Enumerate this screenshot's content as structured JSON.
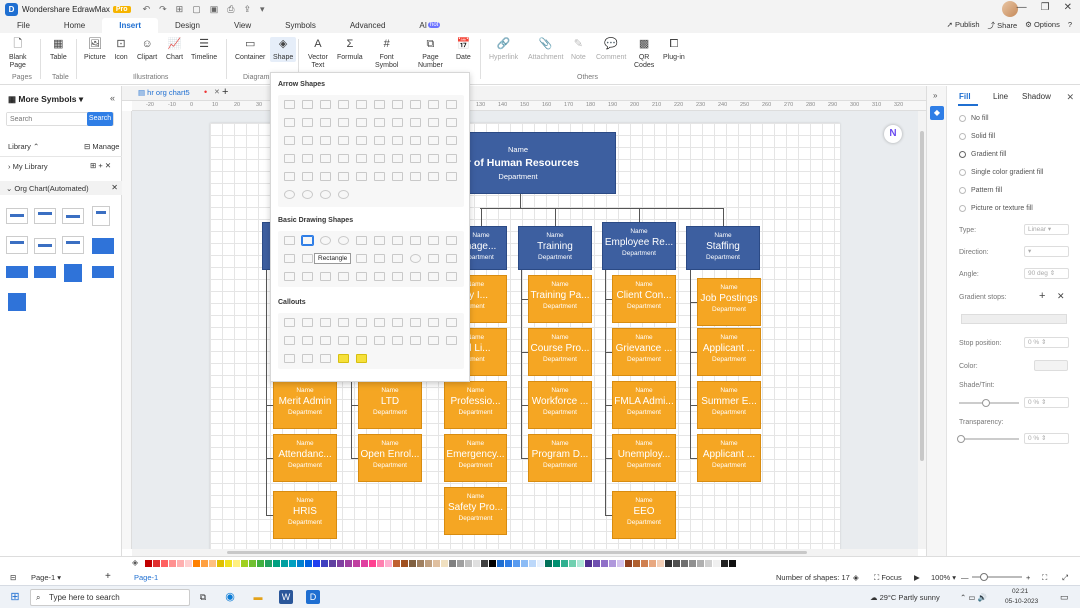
{
  "app": {
    "name": "Wondershare EdrawMax",
    "badge": "Pro",
    "logo": "D"
  },
  "menu": {
    "tabs": [
      "File",
      "Home",
      "Insert",
      "Design",
      "View",
      "Symbols",
      "Advanced",
      "AI"
    ],
    "hot_badge": "hot",
    "active_tab": "Insert",
    "publish": "Publish",
    "share": "Share",
    "options": "Options"
  },
  "ribbon": {
    "blank_page": "Blank\nPage",
    "table": "Table",
    "picture": "Picture",
    "icon": "Icon",
    "clipart": "Clipart",
    "chart": "Chart",
    "timeline": "Timeline",
    "container": "Container",
    "shape": "Shape",
    "vector_text": "Vector\nText",
    "formula": "Formula",
    "font_symbol": "Font\nSymbol",
    "page_number": "Page\nNumber",
    "date": "Date",
    "hyperlink": "Hyperlink",
    "attachment": "Attachment",
    "note": "Note",
    "comment": "Comment",
    "qr_codes": "QR\nCodes",
    "plugin": "Plug-in",
    "groups": {
      "pages": "Pages",
      "table": "Table",
      "illustrations": "Illustrations",
      "diagram": "Diagram",
      "others": "Others"
    }
  },
  "left_panel": {
    "title": "More Symbols",
    "search_placeholder": "Search",
    "search_button": "Search",
    "library": "Library",
    "manage": "Manage",
    "my_library": "My Library",
    "org_chart": "Org Chart(Automated)"
  },
  "document": {
    "tab": "hr org chart5",
    "ruler_ticks": [
      "-20",
      "-10",
      "0",
      "10",
      "20",
      "30",
      "40",
      "50",
      "60",
      "70",
      "80",
      "90",
      "100",
      "110",
      "120",
      "130",
      "140",
      "150",
      "160",
      "170",
      "180",
      "190",
      "200",
      "210",
      "220",
      "230",
      "240",
      "250",
      "260",
      "270",
      "280",
      "290",
      "300",
      "310",
      "320"
    ]
  },
  "org_chart": {
    "root": {
      "name": "Name",
      "title": "tor of Human Resources",
      "dept": "Department"
    },
    "level1": [
      {
        "name": "Name",
        "title": "nage...",
        "dept": "partment"
      },
      {
        "name": "Name",
        "title": "Training",
        "dept": "Department"
      },
      {
        "name": "Name",
        "title": "Employee Re...",
        "dept": "Department"
      },
      {
        "name": "Name",
        "title": "Staffing",
        "dept": "Department"
      }
    ],
    "columns": [
      [
        {
          "name": "Name",
          "title": "Merit Admin",
          "dept": "Department"
        },
        {
          "name": "Name",
          "title": "Attendanc...",
          "dept": "Department"
        },
        {
          "name": "Name",
          "title": "HRIS",
          "dept": "Department"
        }
      ],
      [
        {
          "name": "Name",
          "title": "LTD",
          "dept": "Department"
        },
        {
          "name": "Name",
          "title": "Open Enrol...",
          "dept": "Department"
        }
      ],
      [
        {
          "name": "Name",
          "title": "rty I...",
          "dept": "rtment"
        },
        {
          "name": "Name",
          "title": "ral Li...",
          "dept": "rtment"
        },
        {
          "name": "Name",
          "title": "Professio...",
          "dept": "Department"
        },
        {
          "name": "Name",
          "title": "Emergency...",
          "dept": "Department"
        },
        {
          "name": "Name",
          "title": "Safety Pro...",
          "dept": "Department"
        }
      ],
      [
        {
          "name": "Name",
          "title": "Training Pa...",
          "dept": "Department"
        },
        {
          "name": "Name",
          "title": "Course Pro...",
          "dept": "Department"
        },
        {
          "name": "Name",
          "title": "Workforce ...",
          "dept": "Department"
        },
        {
          "name": "Name",
          "title": "Program D...",
          "dept": "Department"
        }
      ],
      [
        {
          "name": "Name",
          "title": "Client Con...",
          "dept": "Department"
        },
        {
          "name": "Name",
          "title": "Grievance ...",
          "dept": "Department"
        },
        {
          "name": "Name",
          "title": "FMLA Admi...",
          "dept": "Department"
        },
        {
          "name": "Name",
          "title": "Unemploy...",
          "dept": "Department"
        },
        {
          "name": "Name",
          "title": "EEO",
          "dept": "Department"
        }
      ],
      [
        {
          "name": "Name",
          "title": "Job Postings",
          "dept": "Department"
        },
        {
          "name": "Name",
          "title": "Applicant ...",
          "dept": "Department"
        },
        {
          "name": "Name",
          "title": "Summer E...",
          "dept": "Department"
        },
        {
          "name": "Name",
          "title": "Applicant ...",
          "dept": "Department"
        }
      ]
    ]
  },
  "shape_popup": {
    "arrow_shapes": "Arrow Shapes",
    "basic_drawing": "Basic Drawing Shapes",
    "callouts": "Callouts",
    "tooltip": "Rectangle"
  },
  "right_panel": {
    "tabs": [
      "Fill",
      "Line",
      "Shadow"
    ],
    "fill_options": [
      "No fill",
      "Solid fill",
      "Gradient fill",
      "Single color gradient fill",
      "Pattern fill",
      "Picture or texture fill"
    ],
    "type_label": "Type:",
    "type_value": "Linear",
    "direction_label": "Direction:",
    "angle_label": "Angle:",
    "angle_value": "90 deg",
    "gradient_stops": "Gradient stops:",
    "stop_position": "Stop position:",
    "stop_position_value": "0 %",
    "color_label": "Color:",
    "shade_label": "Shade/Tint:",
    "shade_value": "0 %",
    "transparency_label": "Transparency:",
    "transparency_value": "0 %",
    "shade_level": 0.45,
    "transparency_level": 0
  },
  "status": {
    "page_tab": "Page-1",
    "page_active": "Page-1",
    "shapes_count": "Number of shapes: 17",
    "focus": "Focus",
    "zoom": "100%",
    "palette": [
      "#c00000",
      "#e03030",
      "#ff6060",
      "#ff9090",
      "#ffb0b0",
      "#ffd0d0",
      "#ff8000",
      "#ffa040",
      "#ffc080",
      "#e0c000",
      "#f0e020",
      "#fff080",
      "#a0d020",
      "#70c030",
      "#40b040",
      "#20a060",
      "#00a080",
      "#00a0a0",
      "#00a0c0",
      "#0080d0",
      "#0060e0",
      "#2040f0",
      "#4040c0",
      "#6040a0",
      "#8040a0",
      "#a040a0",
      "#c040a0",
      "#e040a0",
      "#ff4090",
      "#ff80b0",
      "#ffb0d0",
      "#c06030",
      "#a05020",
      "#806040",
      "#a08060",
      "#c0a080",
      "#e0c0a0",
      "#f0e0c0",
      "#808080",
      "#a0a0a0",
      "#c0c0c0",
      "#e0e0e0",
      "#404040",
      "#000000",
      "#1f6fd1",
      "#2f7ee6",
      "#5a9cf0",
      "#8cbcf6",
      "#bcd8fa",
      "#e6f0fd",
      "#00705a",
      "#009070",
      "#30b090",
      "#70d0b0",
      "#b0e8d8",
      "#503090",
      "#7050b0",
      "#9070c8",
      "#b098dc",
      "#d4c4ee",
      "#904020",
      "#b06030",
      "#d08050",
      "#e8a880",
      "#f4d0b8",
      "#303030",
      "#505050",
      "#707070",
      "#909090",
      "#b0b0b0",
      "#d0d0d0",
      "#f0f0f0",
      "#222222",
      "#111111"
    ]
  },
  "taskbar": {
    "search": "Type here to search",
    "weather": "29°C Partly sunny",
    "time": "02:21",
    "date": "05-10-2023"
  }
}
